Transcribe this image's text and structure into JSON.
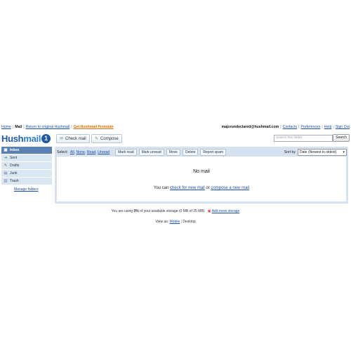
{
  "topnav": {
    "home": "Home",
    "mail": "Mail",
    "return": "Return to original Hushmail",
    "premium": "Get Hushmail Premium"
  },
  "account": {
    "email": "majorundeclared@hushmail.com",
    "contacts": "Contacts",
    "preferences": "Preferences",
    "help": "Help",
    "signout": "Sign Out"
  },
  "logo": {
    "hush": "Hush",
    "mail": "mail",
    "badge": "1"
  },
  "toolbar": {
    "check_mail": "Check mail",
    "compose": "Compose"
  },
  "search": {
    "placeholder": "Search this folder",
    "button": "Search"
  },
  "sidebar": {
    "items": [
      {
        "label": "Inbox",
        "icon": "inbox-icon"
      },
      {
        "label": "Sent",
        "icon": "sent-icon"
      },
      {
        "label": "Drafts",
        "icon": "drafts-icon"
      },
      {
        "label": "Junk",
        "icon": "junk-icon"
      },
      {
        "label": "Trash",
        "icon": "trash-icon"
      }
    ],
    "manage": "Manage folders"
  },
  "messages": {
    "select_label": "Select:",
    "select_all": "All",
    "select_none": "None",
    "select_read": "Read",
    "select_unread": "Unread",
    "actions": [
      "Mark read",
      "Mark unread",
      "Move",
      "Delete",
      "Report spam"
    ],
    "sort_label": "Sort by",
    "sort_value": "Date (Newest to oldest)",
    "empty_title": "No mail",
    "empty_prefix": "You can",
    "empty_check": "check for new mail",
    "empty_or": "or",
    "empty_compose": "compose a new mail"
  },
  "storage": {
    "prefix": "You are using",
    "percent": "0%",
    "suffix": "of your available storage (0 MB of 25 MB)",
    "add": "Add more storage"
  },
  "viewas": {
    "label": "View as:",
    "mobile": "Mobile",
    "desktop": "Desktop"
  },
  "colors": {
    "accent": "#1e5aa8",
    "premium": "#e06a00",
    "sidebar_active": "#5a7fb3",
    "panel_bg": "#d6e2f0"
  }
}
